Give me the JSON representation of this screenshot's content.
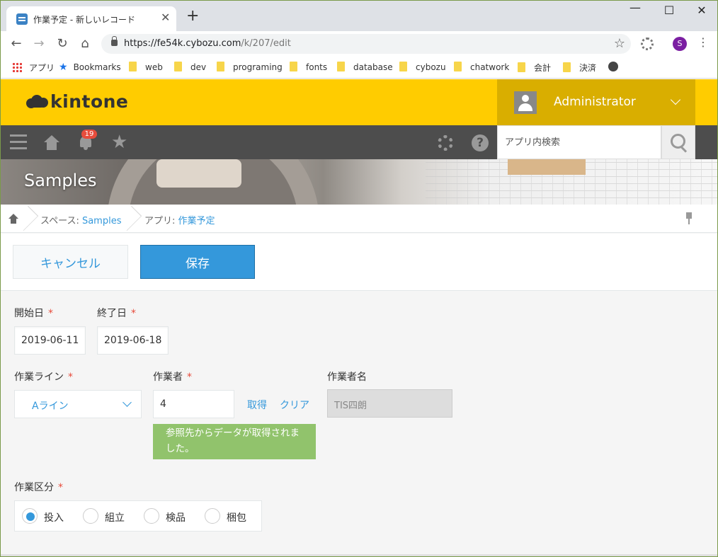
{
  "browser": {
    "tab_title": "作業予定 - 新しいレコード",
    "tab_close": "✕",
    "new_tab": "+",
    "win_min": "—",
    "win_max": "☐",
    "win_close": "✕",
    "url_host": "https://fe54k.cybozu.com",
    "url_path": "/k/207/edit",
    "profile_initial": "S",
    "bookmarks": [
      "アプリ",
      "Bookmarks",
      "web",
      "dev",
      "programing",
      "fonts",
      "database",
      "cybozu",
      "chatwork",
      "会計",
      "決済"
    ]
  },
  "header": {
    "logo_text": "kintone",
    "user_name": "Administrator",
    "notification_count": "19",
    "search_placeholder": "アプリ内検索",
    "help_glyph": "?",
    "favorite_glyph": "★"
  },
  "space": {
    "title": "Samples"
  },
  "breadcrumb": {
    "space_prefix": "スペース: ",
    "space_name": "Samples",
    "app_prefix": "アプリ: ",
    "app_name": "作業予定"
  },
  "actions": {
    "cancel_label": "キャンセル",
    "save_label": "保存"
  },
  "form": {
    "required_mark": "*",
    "start_date": {
      "label": "開始日",
      "value": "2019-06-11"
    },
    "end_date": {
      "label": "終了日",
      "value": "2019-06-18"
    },
    "work_line": {
      "label": "作業ライン",
      "value": "Aライン"
    },
    "worker": {
      "label": "作業者",
      "value": "4",
      "fetch_label": "取得",
      "clear_label": "クリア"
    },
    "worker_name": {
      "label": "作業者名",
      "value": "TIS四朗"
    },
    "lookup_notice": "参照先からデータが取得されました。",
    "work_type": {
      "label": "作業区分",
      "options": [
        "投入",
        "組立",
        "検品",
        "梱包"
      ],
      "selected": "投入"
    }
  },
  "colors": {
    "brand_yellow": "#ffcc00",
    "accent_blue": "#3498db",
    "notice_green": "#91c36c",
    "required_red": "#e74c3c"
  }
}
